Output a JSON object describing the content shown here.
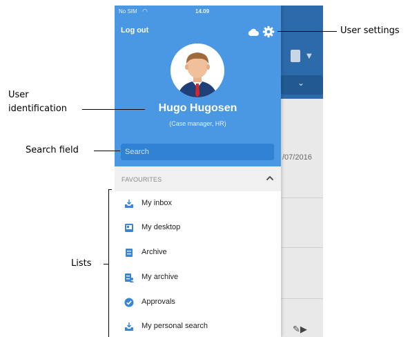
{
  "status_bar": {
    "carrier": "No SIM",
    "time": "14.09"
  },
  "drawer": {
    "logout_label": "Log out",
    "user": {
      "name": "Hugo Hugosen",
      "role": "(Case manager, HR)"
    },
    "search": {
      "placeholder": "Search"
    },
    "favourites": {
      "title": "FAVOURITES",
      "items": [
        {
          "label": "My inbox",
          "icon": "inbox-icon"
        },
        {
          "label": "My desktop",
          "icon": "desktop-icon"
        },
        {
          "label": "Archive",
          "icon": "archive-icon"
        },
        {
          "label": "My archive",
          "icon": "my-archive-icon"
        },
        {
          "label": "Approvals",
          "icon": "check-circle-icon"
        },
        {
          "label": "My personal search",
          "icon": "inbox-icon"
        }
      ]
    }
  },
  "background_app": {
    "date_fragment": "/07/2016"
  },
  "annotations": {
    "user_settings": "User settings",
    "user_identification_line1": "User",
    "user_identification_line2": "identification",
    "search_field": "Search field",
    "lists": "Lists"
  },
  "colors": {
    "drawer_blue": "#4a98e3",
    "search_blue": "#2f82d4",
    "app_header_blue": "#2d6aa9",
    "favourites_bg": "#f0f0f0",
    "icon_blue": "#3b86d4"
  }
}
